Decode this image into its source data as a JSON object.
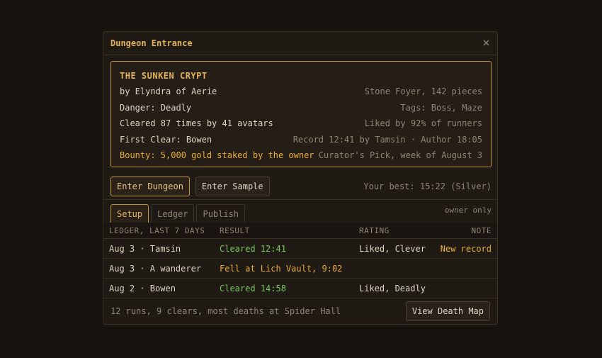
{
  "dialog": {
    "title": "Dungeon Entrance",
    "close_icon": "×"
  },
  "dungeon": {
    "name": "THE SUNKEN CRYPT",
    "rows": [
      {
        "left": "by Elyndra of Aerie",
        "right": "Stone Foyer, 142 pieces"
      },
      {
        "left": "Danger: Deadly",
        "right": "Tags: Boss, Maze"
      },
      {
        "left": "Cleared 87 times by 41 avatars",
        "right": "Liked by 92% of runners"
      },
      {
        "left": "First Clear: Bowen",
        "right": "Record 12:41 by Tamsin · Author 18:05"
      },
      {
        "left": "Bounty: 5,000 gold staked by the owner",
        "right": "Curator's Pick, week of August 3"
      }
    ]
  },
  "actions": {
    "enter_label": "Enter Dungeon",
    "sample_label": "Enter Sample",
    "best": "Your best: 15:22 (Silver)"
  },
  "tabs": {
    "items": [
      "Setup",
      "Ledger",
      "Publish"
    ],
    "active": "Setup",
    "owner_note": "owner only"
  },
  "ledger": {
    "headers": [
      "LEDGER, LAST 7 DAYS",
      "RESULT",
      "RATING",
      "NOTE"
    ],
    "rows": [
      {
        "who": "Aug 3 · Tamsin",
        "result": "Cleared 12:41",
        "result_type": "clear",
        "rating": "Liked, Clever",
        "note": "New record"
      },
      {
        "who": "Aug 3 · A wanderer",
        "result": "Fell at Lich Vault, 9:02",
        "result_type": "death",
        "rating": "",
        "note": ""
      },
      {
        "who": "Aug 2 · Bowen",
        "result": "Cleared 14:58",
        "result_type": "clear",
        "rating": "Liked, Deadly",
        "note": ""
      }
    ]
  },
  "footer": {
    "summary": "12 runs, 9 clears, most deaths at Spider Hall",
    "death_map_label": "View Death Map"
  },
  "colors": {
    "accent": "#e2b25e",
    "clear": "#79c65f",
    "death": "#e8ad3a",
    "background": "#17130e"
  }
}
